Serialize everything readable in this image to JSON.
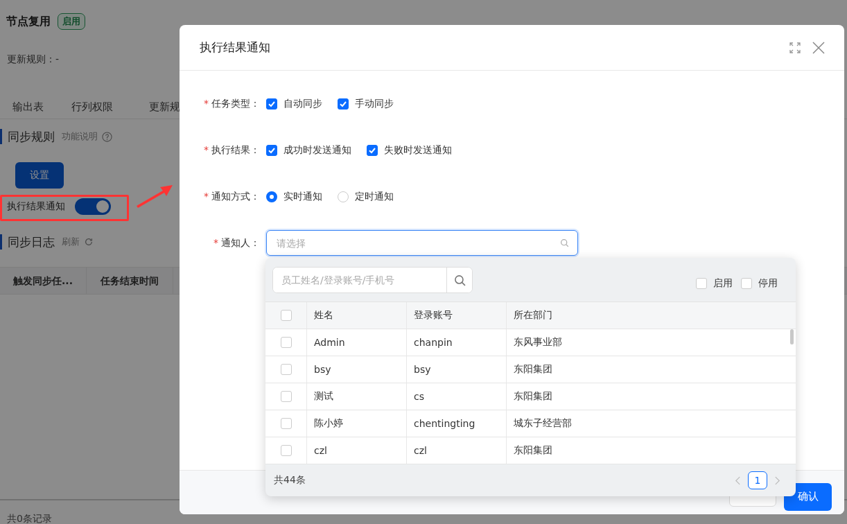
{
  "page": {
    "title": "节点复用",
    "status_tag": "启用",
    "update_rule": "更新规则：-",
    "tabs": [
      {
        "label": "输出表"
      },
      {
        "label": "行列权限"
      },
      {
        "label": "更新规"
      }
    ],
    "sync_rules": {
      "title": "同步规则",
      "help_link": "功能说明",
      "setup_button": "设置",
      "notify_toggle": {
        "label": "执行结果通知",
        "on": true
      }
    },
    "sync_log": {
      "title": "同步日志",
      "refresh": "刷新",
      "columns": [
        "触发同步任...",
        "任务结束时间"
      ],
      "footer": "共0条记录"
    }
  },
  "dialog": {
    "title": "执行结果通知",
    "fields": [
      {
        "label": "任务类型：",
        "required_mark": "*",
        "kind": "checkbox",
        "options": [
          {
            "label": "自动同步",
            "checked": true
          },
          {
            "label": "手动同步",
            "checked": true
          }
        ]
      },
      {
        "label": "执行结果：",
        "required_mark": "*",
        "kind": "checkbox",
        "options": [
          {
            "label": "成功时发送通知",
            "checked": true
          },
          {
            "label": "失败时发送通知",
            "checked": true
          }
        ]
      },
      {
        "label": "通知方式：",
        "required_mark": "*",
        "kind": "radio",
        "options": [
          {
            "label": "实时通知",
            "selected": true
          },
          {
            "label": "定时通知",
            "selected": false
          }
        ]
      },
      {
        "label": "通知人：",
        "required_mark": "*",
        "kind": "select",
        "placeholder": "请选择"
      }
    ],
    "confirm_button": "确认"
  },
  "picker": {
    "search_placeholder": "员工姓名/登录账号/手机号",
    "filters": [
      {
        "label": "启用",
        "checked": false
      },
      {
        "label": "停用",
        "checked": false
      }
    ],
    "select_all_checked": false,
    "columns": [
      "姓名",
      "登录账号",
      "所在部门"
    ],
    "rows": [
      {
        "name": "Admin",
        "account": "chanpin",
        "department": "东风事业部",
        "checked": false
      },
      {
        "name": "bsy",
        "account": "bsy",
        "department": "东阳集团",
        "checked": false
      },
      {
        "name": "测试",
        "account": "cs",
        "department": "东阳集团",
        "checked": false
      },
      {
        "name": "陈小婷",
        "account": "chentingting",
        "department": "城东子经营部",
        "checked": false
      },
      {
        "name": "czl",
        "account": "czl",
        "department": "东阳集团",
        "checked": false
      }
    ],
    "total": "共44条",
    "pages": [
      {
        "label": "1",
        "selected": true
      }
    ]
  }
}
